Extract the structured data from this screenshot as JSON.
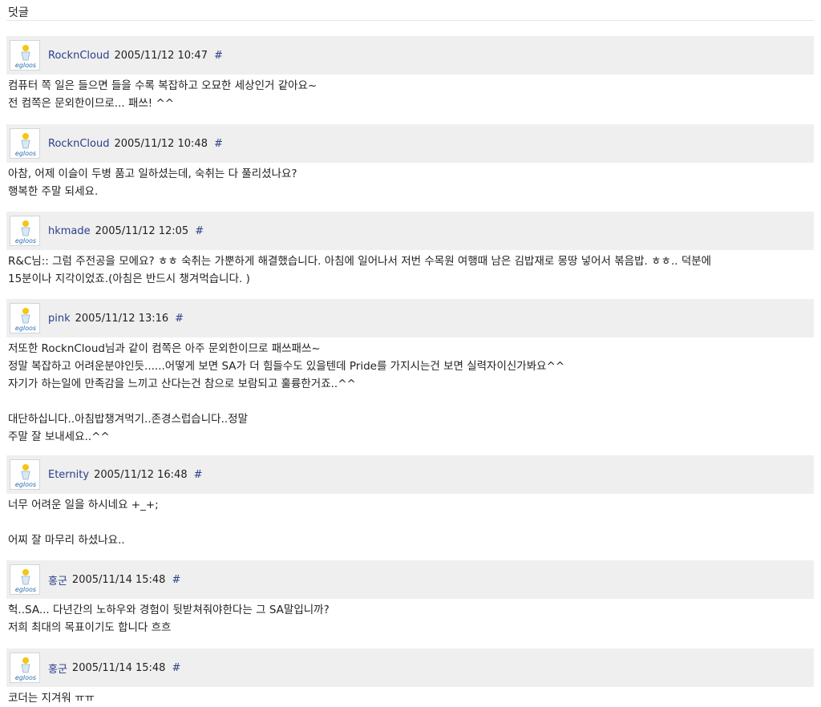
{
  "section_title": "덧글",
  "avatar_label": "egloos",
  "comments": [
    {
      "author": "RocknCloud",
      "date": "2005/11/12 10:47",
      "permalink": "#",
      "lines": [
        "컴퓨터 쪽 일은 들으면 들을 수록 복잡하고 오묘한 세상인거 같아요~",
        "전 컴쪽은 문외한이므로... 패쓰! ^^"
      ]
    },
    {
      "author": "RocknCloud",
      "date": "2005/11/12 10:48",
      "permalink": "#",
      "lines": [
        "아참, 어제 이슬이 두병 품고 일하셨는데, 숙취는 다 풀리셨나요?",
        "행복한 주말 되세요."
      ]
    },
    {
      "author": "hkmade",
      "date": "2005/11/12 12:05",
      "permalink": "#",
      "lines": [
        "R&C님:: 그럼 주전공을 모에요? ㅎㅎ 숙취는 가뿐하게 해결했습니다. 아침에 일어나서 저번 수목원 여행때 남은 김밥재로 몽땅 넣어서 볶음밥. ㅎㅎ.. 덕분에",
        "15분이나 지각이었죠.(아침은 반드시 챙겨먹습니다. )"
      ]
    },
    {
      "author": "pink",
      "date": "2005/11/12 13:16",
      "permalink": "#",
      "lines": [
        "저또한 RocknCloud님과 같이 컴쪽은 아주 문외한이므로 패쓰패쓰~",
        "정말 복잡하고 어려운분야인듯......어떻게 보면 SA가 더 힘들수도 있을텐데 Pride를 가지시는건 보면 실력자이신가봐요^^",
        "자기가 하는일에 만족감을 느끼고 산다는건 참으로 보람되고 훌륭한거죠..^^",
        "",
        "대단하십니다..아침밥챙겨먹기..존경스럽습니다..정말",
        "주말 잘 보내세요..^^"
      ]
    },
    {
      "author": "Eternity",
      "date": "2005/11/12 16:48",
      "permalink": "#",
      "lines": [
        "너무 어려운 일을 하시네요 +_+;",
        "",
        "어찌 잘 마무리 하셨나요.."
      ]
    },
    {
      "author": "홍군",
      "date": "2005/11/14 15:48",
      "permalink": "#",
      "lines": [
        "헉..SA... 다년간의 노하우와 경험이 뒷받쳐줘야한다는 그 SA말입니까?",
        "저희 최대의 목표이기도 합니다 흐흐"
      ]
    },
    {
      "author": "홍군",
      "date": "2005/11/14 15:48",
      "permalink": "#",
      "lines": [
        "코더는 지겨워 ㅠㅠ"
      ]
    }
  ]
}
